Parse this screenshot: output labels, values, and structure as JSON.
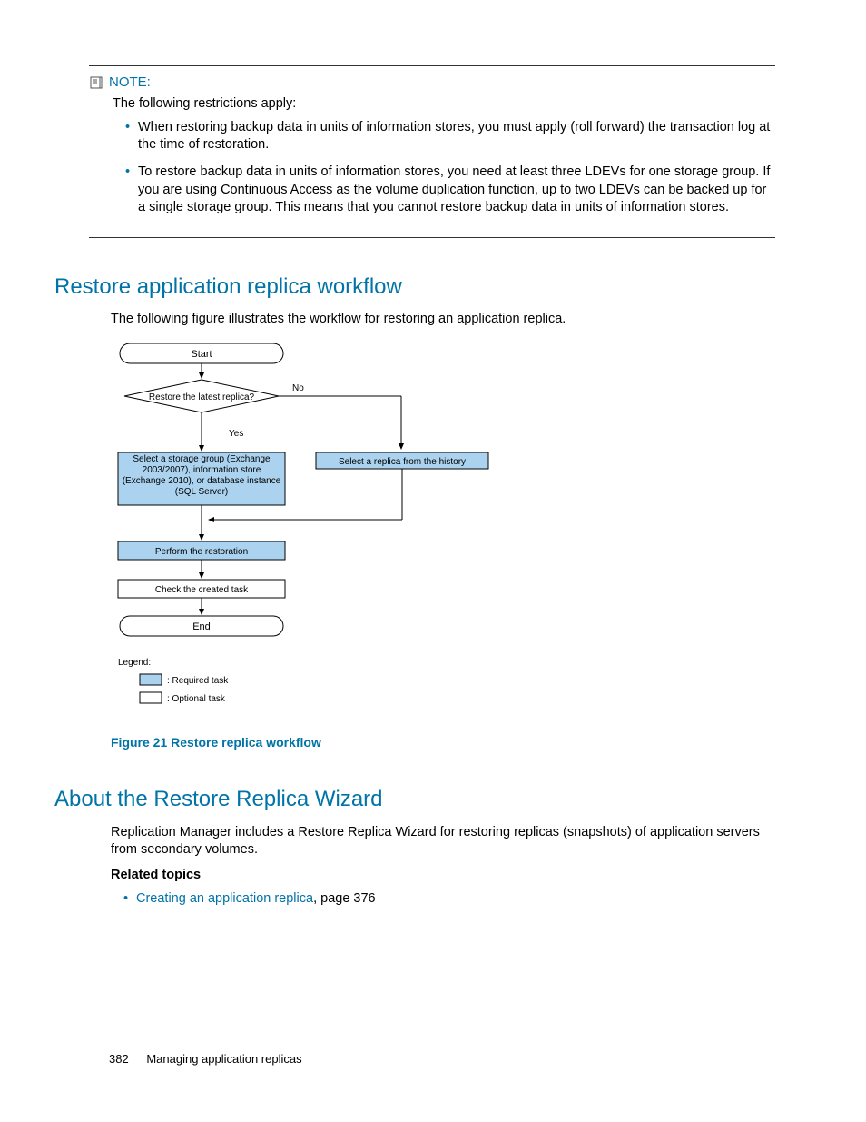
{
  "note": {
    "label": "NOTE:",
    "intro": "The following restrictions apply:",
    "bullets": [
      "When restoring backup data in units of information stores, you must apply (roll forward) the transaction log at the time of restoration.",
      "To restore backup data in units of information stores, you need at least three LDEVs for one storage group. If you are using Continuous Access as the volume duplication function, up to two LDEVs can be backed up for a single storage group. This means that you cannot restore backup data in units of information stores."
    ]
  },
  "section1": {
    "title": "Restore application replica workflow",
    "intro": "The following figure illustrates the workflow for restoring an application replica."
  },
  "flowchart": {
    "start": "Start",
    "decision": "Restore the latest replica?",
    "no": "No",
    "yes": "Yes",
    "left_box": "Select a storage group (Exchange 2003/2007), information store (Exchange 2010), or database instance (SQL Server)",
    "right_box": "Select a replica from the history",
    "perform": "Perform the restoration",
    "check": "Check the created task",
    "end": "End",
    "legend_title": "Legend:",
    "legend_required": ": Required task",
    "legend_optional": ": Optional  task"
  },
  "figure_caption": "Figure 21 Restore replica workflow",
  "section2": {
    "title": "About the Restore Replica Wizard",
    "body": "Replication Manager includes a Restore Replica Wizard for restoring replicas (snapshots) of application servers from secondary volumes.",
    "related_head": "Related topics",
    "related_link": "Creating an application replica",
    "related_suffix": ", page 376"
  },
  "footer": {
    "page": "382",
    "chapter": "Managing application replicas"
  }
}
